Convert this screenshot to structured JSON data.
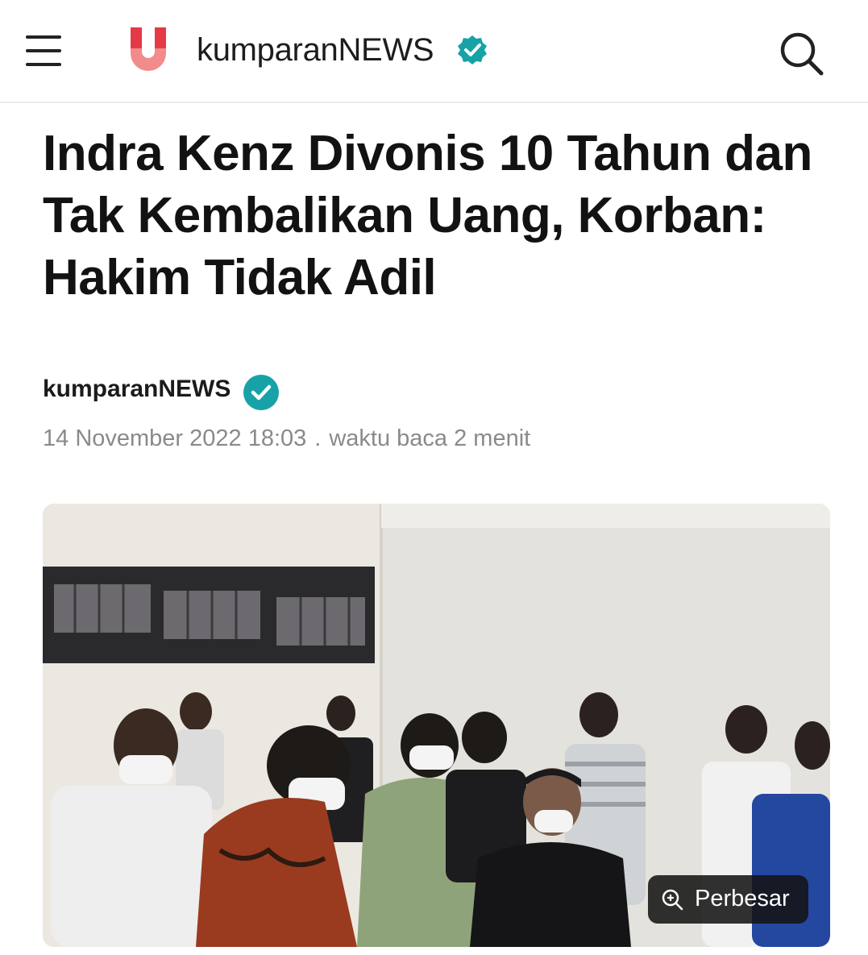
{
  "header": {
    "brand": "kumparanNEWS",
    "logo_icon": "kumparan-u-logo",
    "menu_icon": "hamburger-menu-icon",
    "search_icon": "search-icon",
    "verified_icon": "verified-badge-icon"
  },
  "article": {
    "title": "Indra Kenz Divonis 10 Tahun dan Tak Kembalikan Uang, Korban: Hakim Tidak Adil",
    "author": "kumparanNEWS",
    "date": "14 November 2022 18:03",
    "separator": ".",
    "read_time": "waktu baca 2 menit"
  },
  "image": {
    "zoom_label": "Perbesar",
    "zoom_icon": "zoom-in-icon"
  },
  "colors": {
    "brand_red": "#e63946",
    "brand_pink": "#f28b8b",
    "verified_teal": "#17a2a8",
    "text_meta": "#8a8a8a"
  }
}
